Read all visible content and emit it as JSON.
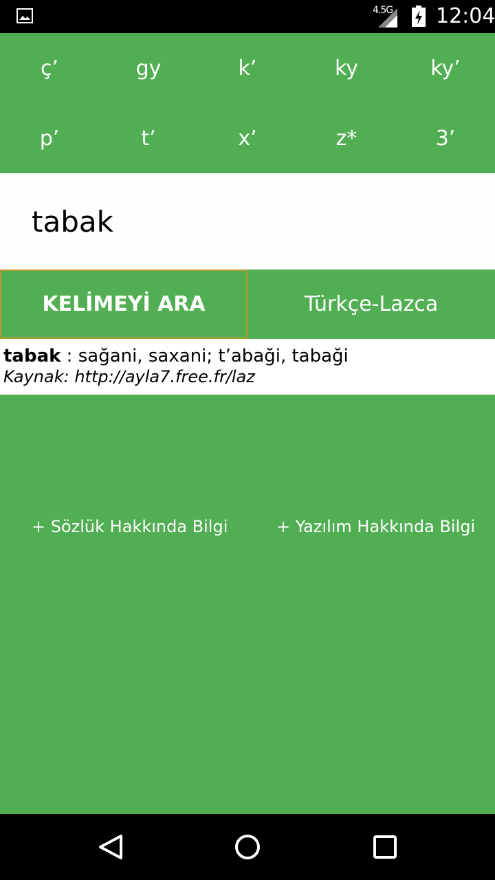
{
  "status_bar": {
    "network": "4.5G",
    "time": "12:04",
    "icons": [
      "gallery-icon",
      "signal-icon",
      "battery-charging-icon"
    ]
  },
  "keypad": {
    "keys": [
      "ç’",
      "gy",
      "k’",
      "ky",
      "ky’",
      "p’",
      "t’",
      "x’",
      "z*",
      "3’"
    ]
  },
  "search": {
    "value": "tabak"
  },
  "buttons": {
    "search_label": "KELİMEYİ ARA",
    "direction_label": "Türkçe-Lazca"
  },
  "result": {
    "word": "tabak",
    "definition": " : sağani, saxani; t’abaği, tabaği",
    "source": "Kaynak: http://ayla7.free.fr/laz"
  },
  "info_links": {
    "dictionary": "+ Sözlük Hakkında Bilgi",
    "software": "+ Yazılım Hakkında Bilgi"
  },
  "nav_bar": {
    "icons": [
      "back-icon",
      "home-icon",
      "recents-icon"
    ]
  },
  "colors": {
    "primary_green": "#52ae52",
    "search_button_border": "#b59a2a",
    "status_bar": "#000000"
  }
}
